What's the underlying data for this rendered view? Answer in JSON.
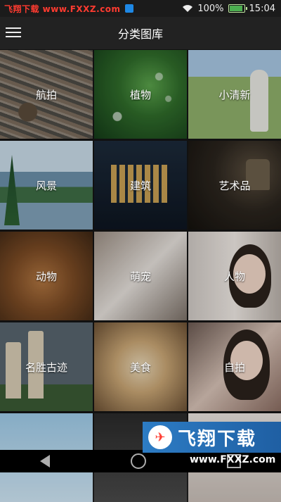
{
  "status_bar": {
    "watermark": "飞翔下载 www.FXXZ.com",
    "battery_percent": "100%",
    "time": "15:04",
    "battery_level": 1.0,
    "icons": [
      "notification-badge-icon",
      "wifi-icon",
      "battery-icon"
    ]
  },
  "app_bar": {
    "title": "分类图库",
    "menu_icon": "menu-icon"
  },
  "categories": [
    {
      "label": "航拍"
    },
    {
      "label": "植物"
    },
    {
      "label": "小清新"
    },
    {
      "label": "风景"
    },
    {
      "label": "建筑"
    },
    {
      "label": "艺术品"
    },
    {
      "label": "动物"
    },
    {
      "label": "萌宠"
    },
    {
      "label": "人物"
    },
    {
      "label": "名胜古迹"
    },
    {
      "label": "美食"
    },
    {
      "label": "自拍"
    }
  ],
  "watermark_banner": {
    "text": "飞翔下载",
    "url": "www.FXXZ.com"
  },
  "colors": {
    "accent_red": "#ff3b30",
    "banner_blue": "#2d7cc4"
  }
}
